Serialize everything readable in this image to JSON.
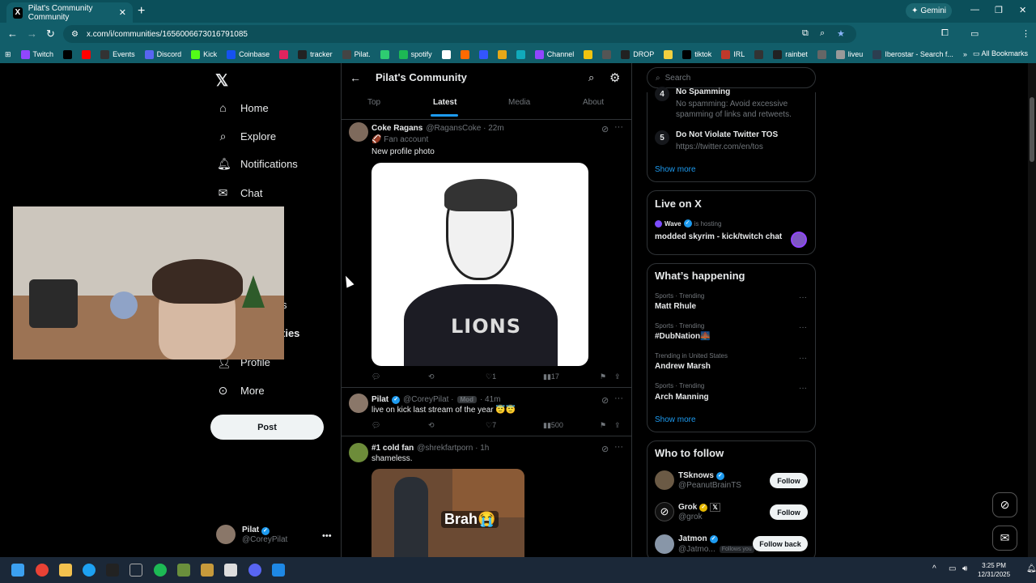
{
  "browser": {
    "tab_title": "Pilat's Community Community",
    "tab_close": "✕",
    "new_tab": "+",
    "gemini_label": "Gemini",
    "url": "x.com/i/communities/1656006673016791085",
    "window_controls": {
      "minimize": "—",
      "restore": "❐",
      "close": "✕"
    },
    "bookmarks": [
      {
        "label": "Twitch",
        "color": "#9146ff"
      },
      {
        "label": "",
        "color": "#000000"
      },
      {
        "label": "",
        "color": "#ff0000"
      },
      {
        "label": "Events",
        "color": "#333333"
      },
      {
        "label": "Discord",
        "color": "#5865f2"
      },
      {
        "label": "Kick",
        "color": "#53fc18"
      },
      {
        "label": "Coinbase",
        "color": "#1652f0"
      },
      {
        "label": "",
        "color": "#e0245e"
      },
      {
        "label": "tracker",
        "color": "#222222"
      },
      {
        "label": "Pilat.",
        "color": "#444444"
      },
      {
        "label": "",
        "color": "#2ecc71"
      },
      {
        "label": "spotify",
        "color": "#1db954"
      },
      {
        "label": "",
        "color": "#ffffff"
      },
      {
        "label": "",
        "color": "#ff6a00"
      },
      {
        "label": "",
        "color": "#3355ff"
      },
      {
        "label": "",
        "color": "#e6a817"
      },
      {
        "label": "",
        "color": "#11aabb"
      },
      {
        "label": "Channel",
        "color": "#9146ff"
      },
      {
        "label": "",
        "color": "#f1c40f"
      },
      {
        "label": "",
        "color": "#555555"
      },
      {
        "label": "DROP",
        "color": "#222222"
      },
      {
        "label": "",
        "color": "#f4d03f"
      },
      {
        "label": "tiktok",
        "color": "#000000"
      },
      {
        "label": "IRL",
        "color": "#c0392b"
      },
      {
        "label": "",
        "color": "#333333"
      },
      {
        "label": "rainbet",
        "color": "#222222"
      },
      {
        "label": "",
        "color": "#666666"
      },
      {
        "label": "liveu",
        "color": "#999999"
      },
      {
        "label": "Iberostar - Search f...",
        "color": "#2c3e50"
      }
    ],
    "more_bookmarks": "»",
    "all_bookmarks": "All Bookmarks"
  },
  "leftnav": {
    "logo": "𝕏",
    "items": [
      {
        "label": "Home",
        "icon": "home-icon"
      },
      {
        "label": "Explore",
        "icon": "search-icon"
      },
      {
        "label": "Notifications",
        "icon": "bell-icon"
      },
      {
        "label": "Chat",
        "icon": "mail-icon"
      },
      {
        "label": "s",
        "icon": ""
      },
      {
        "label": "ties",
        "icon": ""
      },
      {
        "label": "Profile",
        "icon": "person-icon"
      },
      {
        "label": "More",
        "icon": "more-circle-icon"
      }
    ],
    "post_button": "Post",
    "account": {
      "name": "Pilat",
      "handle": "@CoreyPilat",
      "more": "•••"
    }
  },
  "community": {
    "title": "Pilat's Community",
    "tabs": [
      "Top",
      "Latest",
      "Media",
      "About"
    ],
    "active_tab": "Latest"
  },
  "posts": [
    {
      "name": "Coke Ragans",
      "handle": "@RagansCoke · 22m",
      "sub": "🏈 Fan account",
      "text": "New profile photo",
      "image_text": "LIONS",
      "replies": "",
      "reposts": "",
      "likes": "1",
      "views": "17"
    },
    {
      "name": "Pilat",
      "handle": "@CoreyPilat ·",
      "badge": "Mod",
      "time": "· 41m",
      "text": "live on kick last stream of the year 😇😇",
      "replies": "",
      "reposts": "",
      "likes": "7",
      "views": "500"
    },
    {
      "name": "#1 cold fan",
      "handle": "@shrekfartporn · 1h",
      "text": "shameless.",
      "image_text": "Brah😭"
    }
  ],
  "right": {
    "search_placeholder": "Search",
    "rules": [
      {
        "num": "4",
        "title": "No Spamming",
        "desc": "No spamming: Avoid excessive spamming of links and retweets."
      },
      {
        "num": "5",
        "title": "Do Not Violate Twitter TOS",
        "desc": "https://twitter.com/en/tos"
      }
    ],
    "rules_show_more": "Show more",
    "live": {
      "title": "Live on X",
      "host": "Wave",
      "hosting": "is hosting",
      "space_title": "modded skyrim - kick/twitch chat"
    },
    "happening": {
      "title": "What’s happening",
      "trends": [
        {
          "meta": "Sports · Trending",
          "name": "Matt Rhule"
        },
        {
          "meta": "Sports · Trending",
          "name": "#DubNation🌉"
        },
        {
          "meta": "Trending in United States",
          "name": "Andrew Marsh"
        },
        {
          "meta": "Sports · Trending",
          "name": "Arch Manning"
        }
      ],
      "show_more": "Show more"
    },
    "who_to_follow": {
      "title": "Who to follow",
      "accounts": [
        {
          "name": "TSknows",
          "handle": "@PeanutBrainTS",
          "button": "Follow",
          "follows_you": ""
        },
        {
          "name": "Grok",
          "handle": "@grok",
          "button": "Follow",
          "follows_you": ""
        },
        {
          "name": "Jatmon",
          "handle": "@Jatmo...",
          "button": "Follow back",
          "follows_you": "Follows you"
        }
      ]
    }
  },
  "taskbar": {
    "time": "3:25 PM",
    "date": "12/31/2025",
    "tray_chevron": "^"
  }
}
